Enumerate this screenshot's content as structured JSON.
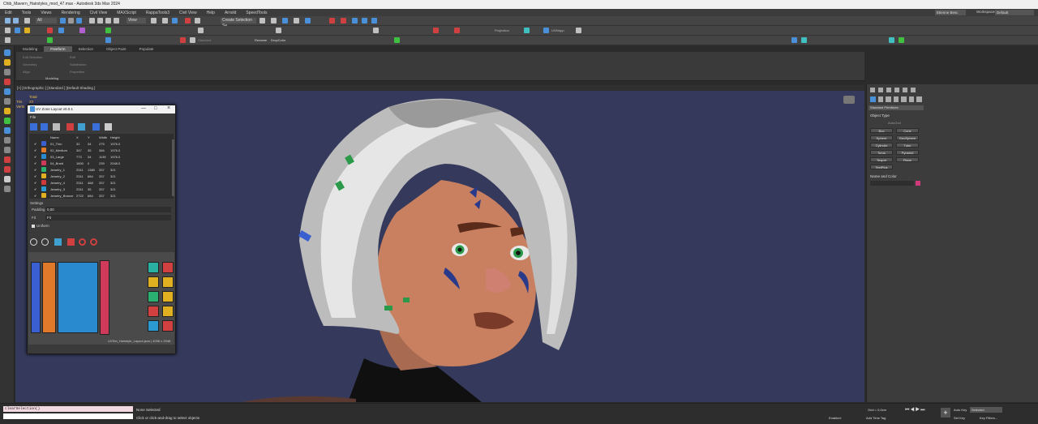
{
  "window": {
    "title": "Chib_Mavern_Hairstyles_mod_47.max - Autodesk 3ds Max 2024"
  },
  "menu": [
    "Edit",
    "Tools",
    "Views",
    "Rendering",
    "Civil View",
    "MAXScript",
    "RappaTools3",
    "Civil View",
    "Help",
    "Arnold",
    "SpeedTools"
  ],
  "user": "Etienne Besc",
  "workspace": {
    "label": "Workspaces:",
    "value": "Default"
  },
  "toolbar": {
    "selection_set": "Create Selection Se",
    "view_dropdown": "View",
    "all_dropdown": "All",
    "standard": "Standard",
    "rename": "Rename",
    "dropcolor": "DropColor",
    "projection": "Projection",
    "uvmap": "UVMapp"
  },
  "ribbon": {
    "tabs": [
      "Modeling",
      "Freeform",
      "Selection",
      "Object Paint",
      "Populate"
    ],
    "active_tab": "Freeform",
    "items": [
      "Edit Selection",
      "Edit",
      "Geometry",
      "Subdivision",
      "Align",
      "Properties"
    ],
    "group_label": "Modeling"
  },
  "viewport": {
    "label": "[+] [Orthographic ] [Standard ] [Default Shading ]",
    "stats": {
      "total_label": "Total",
      "tris_label": "Tris",
      "tris_value": "23 229",
      "verts_label": "Verts",
      "verts_value": "1"
    }
  },
  "dialog": {
    "title": "UV Zone Layout v0.0.1",
    "menu_file": "File",
    "columns": [
      "Name",
      "X",
      "Y",
      "Width",
      "Height"
    ],
    "rows": [
      {
        "name": "01_Thin",
        "x": "32",
        "y": "34",
        "w": "275",
        "h": "1976.0",
        "color": "#3a5fd0"
      },
      {
        "name": "02_Medium",
        "x": "347",
        "y": "35",
        "w": "366",
        "h": "1976.0",
        "color": "#e07a2a"
      },
      {
        "name": "03_Large",
        "x": "773",
        "y": "34",
        "w": "1135",
        "h": "1976.0",
        "color": "#2a8ad0"
      },
      {
        "name": "04_Braid",
        "x": "1600",
        "y": "0",
        "w": "239",
        "h": "2048.0",
        "color": "#d03a5a"
      },
      {
        "name": "Jewelry_1",
        "x": "2311",
        "y": "1380",
        "w": "337",
        "h": "321",
        "color": "#2ab070"
      },
      {
        "name": "Jewelry_2",
        "x": "2311",
        "y": "684",
        "w": "337",
        "h": "321",
        "color": "#e0b020"
      },
      {
        "name": "Jewelry_4",
        "x": "2311",
        "y": "468",
        "w": "337",
        "h": "321",
        "color": "#d03a3a"
      },
      {
        "name": "Jewelry_3",
        "x": "2311",
        "y": "35",
        "w": "337",
        "h": "321",
        "color": "#2a9ad0"
      },
      {
        "name": "Jewelry_Bronze",
        "x": "2722",
        "y": "684",
        "w": "337",
        "h": "321",
        "color": "#e0b020"
      }
    ],
    "settings_label": "Settings",
    "padding_label": "Padding",
    "padding_value": "0,00",
    "fit_label": "Fit",
    "fit_value": "Fit",
    "uniform_label": "Uniform",
    "footer": "UVSet_Hairstyle_Layout.json | 4096 x 2048"
  },
  "command_panel": {
    "dropdown": "Standard Primitives",
    "object_type": "Object Type",
    "autogrid": "AutoGrid",
    "buttons": [
      "Box",
      "Cone",
      "Sphere",
      "GeoSphere",
      "Cylinder",
      "Tube",
      "Torus",
      "Pyramid",
      "Teapot",
      "Plane",
      "TextPlus"
    ],
    "name_color": "Name and Color"
  },
  "status": {
    "listener": "clearSelection()",
    "prompt_1": "None Selected",
    "prompt_2": "Click or click-and-drag to select objects",
    "grid": "Grid = 0,0cm",
    "autokey": "Auto Key",
    "selected": "Selected",
    "setkey": "Set Key",
    "keyfilters": "Key Filters...",
    "enabled": "Enabled:",
    "addtime": "Add Time Tag"
  },
  "colors": {
    "viewport_bg": "#353a5c",
    "accent": "#4a90d9"
  }
}
